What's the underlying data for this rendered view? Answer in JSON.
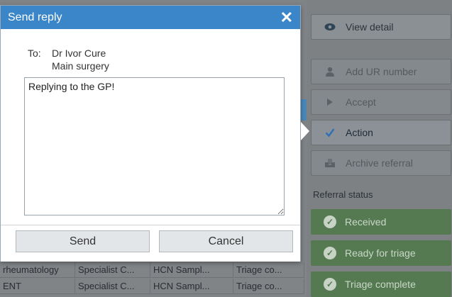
{
  "dialog": {
    "title": "Send reply",
    "close_glyph": "✕",
    "to_label": "To:",
    "recipient_name": "Dr Ivor Cure",
    "recipient_location": "Main surgery",
    "message": "Replying to the GP!",
    "send_label": "Send",
    "cancel_label": "Cancel"
  },
  "actions": {
    "view_detail": "View detail",
    "add_ur": "Add UR number",
    "accept": "Accept",
    "action": "Action",
    "archive": "Archive referral"
  },
  "referral_status": {
    "heading": "Referral status",
    "items": [
      "Received",
      "Ready for triage",
      "Triage complete"
    ]
  },
  "table": {
    "rows": [
      [
        "rheumatology",
        "Specialist C...",
        "HCN Sampl...",
        "Triage co..."
      ],
      [
        "ENT",
        "Specialist C...",
        "HCN Sampl...",
        "Triage co..."
      ]
    ]
  },
  "icons": {
    "view": "eye-icon",
    "add_ur": "person-icon",
    "accept": "play-icon",
    "action": "checkmark-icon",
    "archive": "archive-box-icon",
    "status": "check-circle-icon",
    "close": "close-icon"
  },
  "colors": {
    "header": "#3a86c8",
    "status_green": "#557a52",
    "action_check": "#2f6fb5"
  }
}
